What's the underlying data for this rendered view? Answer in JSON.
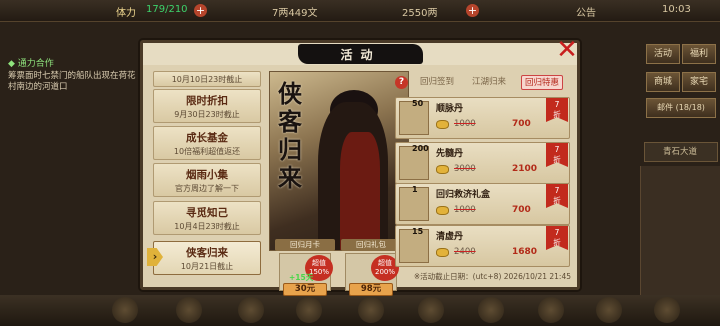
{
  "hud": {
    "stamina_label": "体力",
    "stamina_value": "179/210",
    "coins": "7两449文",
    "gold": "2550两",
    "notice": "公告",
    "time": "10:03"
  },
  "quest": {
    "title": "◆ 通力合作",
    "desc": "筹票面时七禁门的船队出现在荷花村南边的河道口"
  },
  "side": {
    "activity": "活动",
    "welfare": "福利",
    "shop": "商城",
    "home": "家宅",
    "mail_label": "邮件",
    "mail_count": "(18/18)",
    "chat": "青石大道"
  },
  "modal": {
    "title": "活动"
  },
  "tabs": [
    {
      "title": "",
      "sub": "10月10日23时截止"
    },
    {
      "title": "限时折扣",
      "sub": "9月30日23时截止"
    },
    {
      "title": "成长基金",
      "sub": "10倍福利超值返还"
    },
    {
      "title": "烟雨小集",
      "sub": "官方周边了解一下"
    },
    {
      "title": "寻觅知己",
      "sub": "10月4日23时截止"
    },
    {
      "title": "侠客归来",
      "sub": "10月21日截止"
    }
  ],
  "hero": {
    "calligraphy": "侠客归来"
  },
  "cards": [
    {
      "label": "回归月卡",
      "tag1": "超值",
      "tag2": "150%",
      "sub": "+15天",
      "price": "30元"
    },
    {
      "label": "回归礼包",
      "tag1": "超值",
      "tag2": "200%",
      "sub": "",
      "price": "98元"
    }
  ],
  "list_tabs": [
    "回归签到",
    "江湖归来",
    "回归特惠"
  ],
  "items": [
    {
      "qty": "50",
      "name": "顺脉丹",
      "old": "1000",
      "new": "700",
      "disc1": "7",
      "disc2": "折"
    },
    {
      "qty": "200",
      "name": "先髓丹",
      "old": "3000",
      "new": "2100",
      "disc1": "7",
      "disc2": "折"
    },
    {
      "qty": "1",
      "name": "回归救济礼盒",
      "old": "1000",
      "new": "700",
      "disc1": "7",
      "disc2": "折"
    },
    {
      "qty": "15",
      "name": "清虚丹",
      "old": "2400",
      "new": "1680",
      "disc1": "7",
      "disc2": "折"
    }
  ],
  "footer": "※活动截止日期：(utc+8) 2026/10/21 21:45",
  "colors": {
    "accent": "#c52f22",
    "parchment": "#ddd0b1",
    "title_brush": "#141110"
  }
}
